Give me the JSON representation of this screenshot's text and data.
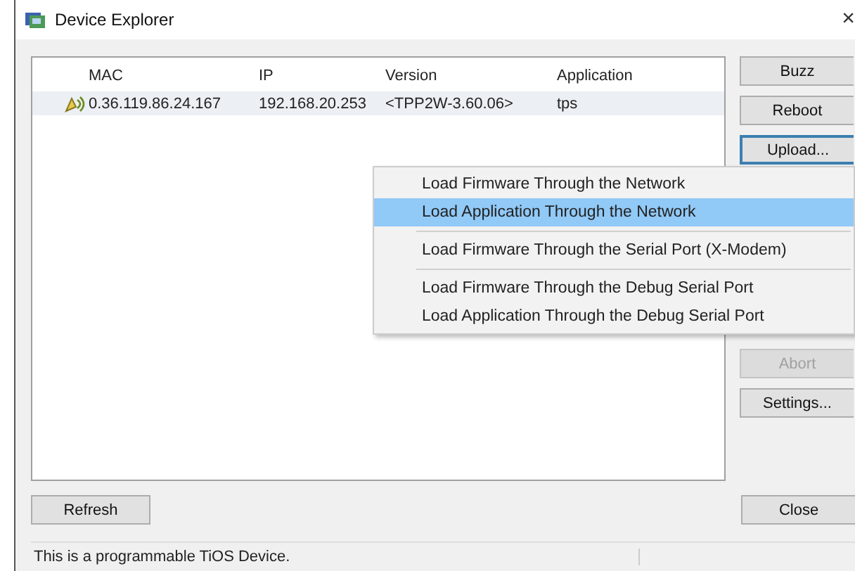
{
  "window": {
    "title": "Device Explorer",
    "close": "×"
  },
  "table": {
    "columns": [
      "MAC",
      "IP",
      "Version",
      "Application"
    ],
    "rows": [
      {
        "selected": true,
        "cells": [
          "0.36.119.86.24.167",
          "192.168.20.253",
          "<TPP2W-3.60.06>",
          "tps"
        ]
      }
    ]
  },
  "buttons": [
    {
      "label": "Buzz",
      "disabled": false,
      "focused": false
    },
    {
      "label": "Reboot",
      "disabled": false,
      "focused": false
    },
    {
      "label": "Upload...",
      "disabled": false,
      "focused": true
    },
    {
      "label": "Abort",
      "disabled": true,
      "focused": false
    },
    {
      "label": "Settings...",
      "disabled": false,
      "focused": false
    }
  ],
  "menu": [
    {
      "kind": "item",
      "label": "Load Firmware Through the Network",
      "selected": false
    },
    {
      "kind": "item",
      "label": "Load Application Through the Network",
      "selected": true
    },
    {
      "kind": "separator"
    },
    {
      "kind": "item",
      "label": "Load Firmware Through the Serial Port (X-Modem)",
      "selected": false
    },
    {
      "kind": "separator"
    },
    {
      "kind": "item",
      "label": "Load Firmware Through the Debug Serial Port",
      "selected": false
    },
    {
      "kind": "item",
      "label": "Load Application Through the Debug Serial Port",
      "selected": false
    }
  ],
  "refresh_button": "Refresh",
  "close_button": "Close",
  "status_bar": "This is a programmable TiOS Device."
}
